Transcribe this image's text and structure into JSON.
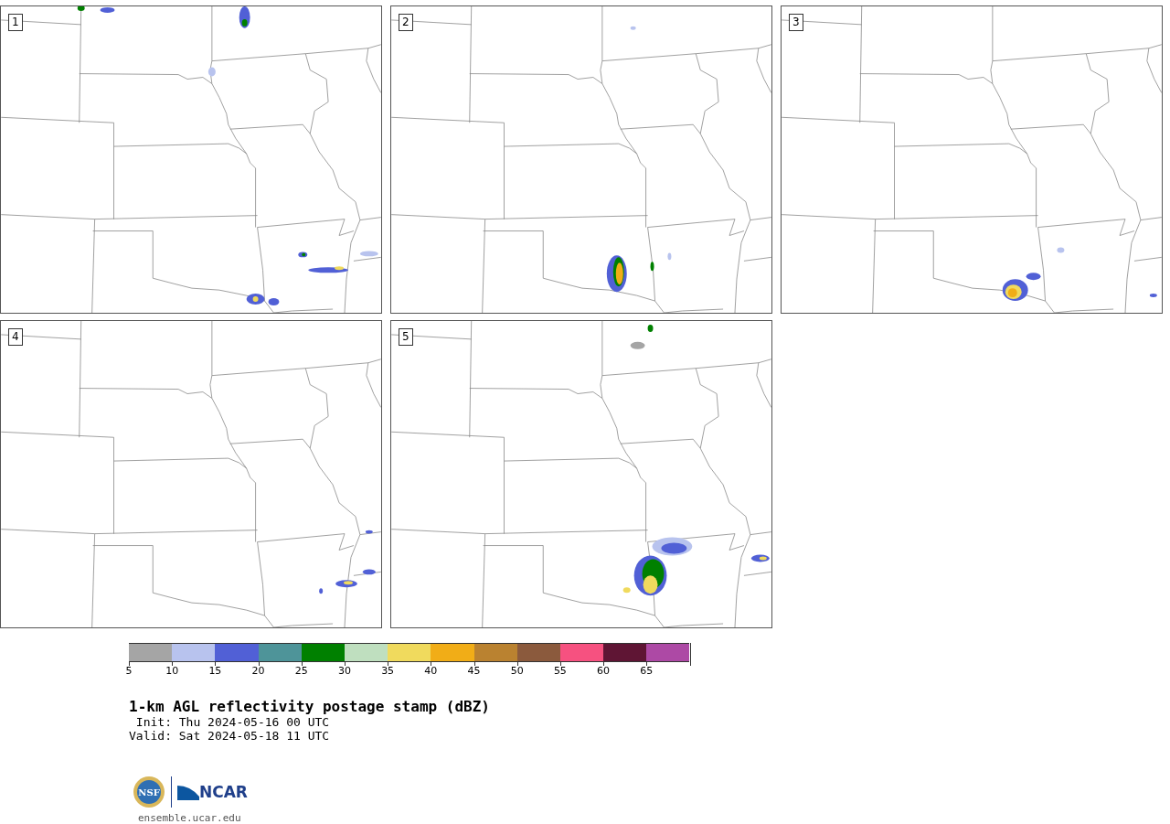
{
  "panels": [
    {
      "label": "1"
    },
    {
      "label": "2"
    },
    {
      "label": "3"
    },
    {
      "label": "4"
    },
    {
      "label": "5"
    }
  ],
  "colorbar": {
    "segments": [
      {
        "color": "#a5a5a5",
        "label": "5"
      },
      {
        "color": "#b8c3ee",
        "label": "10"
      },
      {
        "color": "#5160d6",
        "label": "15"
      },
      {
        "color": "#4e9499",
        "label": "20"
      },
      {
        "color": "#008000",
        "label": "25"
      },
      {
        "color": "#bfdfbf",
        "label": "30"
      },
      {
        "color": "#f0da5d",
        "label": "35"
      },
      {
        "color": "#f1ad17",
        "label": "40"
      },
      {
        "color": "#ba8230",
        "label": "45"
      },
      {
        "color": "#8b5a3d",
        "label": "50"
      },
      {
        "color": "#f65180",
        "label": "55"
      },
      {
        "color": "#5f1534",
        "label": "60"
      },
      {
        "color": "#ad49a5",
        "label": "65"
      }
    ]
  },
  "title": "1-km AGL reflectivity postage stamp (dBZ)",
  "init": " Init: Thu 2024-05-16 00 UTC",
  "valid": "Valid: Sat 2024-05-18 11 UTC",
  "logo": {
    "nsf": "NSF",
    "ncar": "NCAR"
  },
  "url": "ensemble.ucar.edu"
}
